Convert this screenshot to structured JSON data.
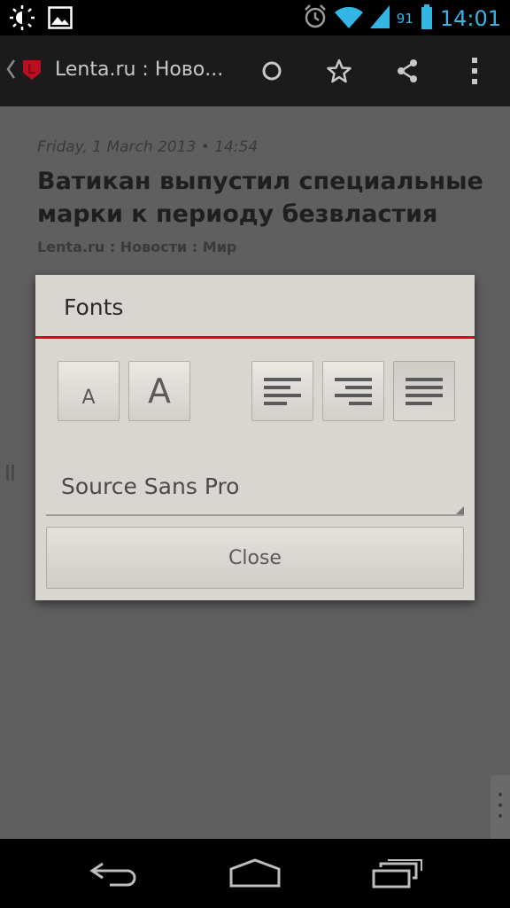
{
  "status_bar": {
    "time": "14:01",
    "battery_level": "91",
    "icons": [
      "brightness-icon",
      "image-icon",
      "alarm-icon",
      "wifi-icon",
      "signal-icon",
      "battery-icon"
    ]
  },
  "action_bar": {
    "title": "Lenta.ru : Ново...",
    "icons": [
      "back-chevron-icon",
      "lenta-logo-icon",
      "circle-icon",
      "star-icon",
      "share-icon",
      "overflow-menu-icon"
    ]
  },
  "article": {
    "date": "Friday, 1 March 2013 • 14:54",
    "title": "Ватикан выпустил специальные марки к периоду безвластия",
    "source": "Lenta.ru : Новости : Мир"
  },
  "dialog": {
    "title": "Fonts",
    "decrease_font_label": "A",
    "increase_font_label": "A",
    "font_name": "Source Sans Pro",
    "close_label": "Close",
    "selected_alignment": "justify",
    "accent_color": "#e2001a"
  },
  "nav_bar": {
    "icons": [
      "back-icon",
      "home-icon",
      "recent-apps-icon"
    ]
  },
  "colors": {
    "status_accent": "#33b5e5",
    "overlay_background": "#5f5f5f",
    "dialog_background": "#d9d6d1"
  }
}
